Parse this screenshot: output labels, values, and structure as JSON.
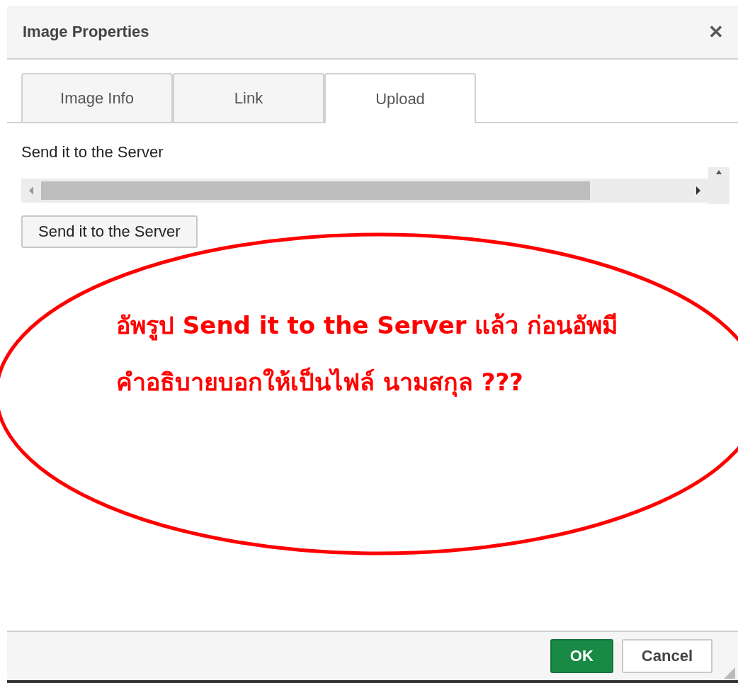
{
  "dialog": {
    "title": "Image Properties",
    "close": "✕"
  },
  "tabs": [
    {
      "label": "Image Info",
      "selected": false
    },
    {
      "label": "Link",
      "selected": false
    },
    {
      "label": "Upload",
      "selected": true
    }
  ],
  "upload": {
    "label": "Send it to the Server",
    "button": "Send it to the Server"
  },
  "annotation": {
    "lines": [
      "อัพรูป Send it to the Server แล้ว ก่อนอัพมี",
      "คำอธิบายบอกให้เป็นไฟล์ นามสกุล ???"
    ]
  },
  "footer": {
    "buttons": [
      {
        "label": "OK",
        "kind": "primary"
      },
      {
        "label": "Cancel",
        "kind": "secondary"
      }
    ]
  }
}
